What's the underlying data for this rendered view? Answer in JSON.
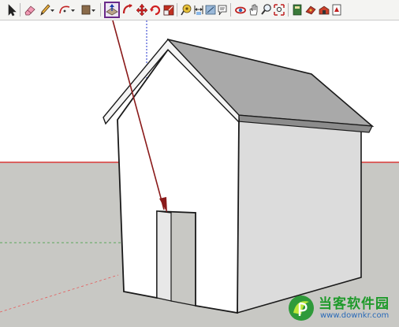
{
  "toolbar": {
    "tools": [
      "select-icon",
      "eraser-icon",
      "pencil-icon",
      "arc-icon",
      "rectangle-icon",
      "push-pull-icon",
      "follow-me-icon",
      "move-icon",
      "rotate-icon",
      "scale-icon",
      "tape-measure-icon",
      "dimension-icon",
      "protractor-icon",
      "text-icon",
      "orbit-icon",
      "pan-icon",
      "zoom-icon",
      "zoom-extents-icon",
      "components-icon",
      "materials-icon",
      "shadows-icon",
      "styles-icon"
    ],
    "active_tool": "push-pull-icon"
  },
  "colors": {
    "toolbar_bg": "#f4f4f2",
    "sky": "#ffffff",
    "ground": "#c8c8c4",
    "red_axis": "#e52424",
    "green_axis": "#3a9a3a",
    "blue_axis": "#2233cc",
    "roof": "#a9a9a9",
    "wall_front": "#ffffff",
    "wall_side": "#dcdcdc",
    "arrow": "#8a1a1a",
    "active_highlight": "#6a2a8a"
  },
  "watermark": {
    "title": "当客软件园",
    "url": "www.downkr.com"
  }
}
